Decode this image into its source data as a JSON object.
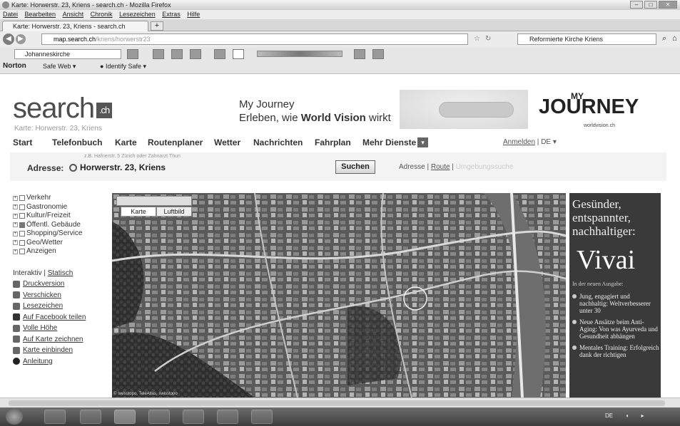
{
  "window": {
    "title": "Karte: Horwerstr. 23, Kriens - search.ch - Mozilla Firefox"
  },
  "menu": [
    "Datei",
    "Bearbeiten",
    "Ansicht",
    "Chronik",
    "Lesezeichen",
    "Extras",
    "Hilfe"
  ],
  "tab": {
    "label": "Karte: Horwerstr. 23, Kriens - search.ch"
  },
  "navbar": {
    "url_domain": "map.search.ch",
    "url_rest": "/kriens/horwerstr23",
    "search_value": "Reformierte Kirche Kriens"
  },
  "toolbar": {
    "search_value": "Johanneskirche",
    "norton_label": "Norton",
    "safeweb_label": "Safe Web",
    "identity_label": "Identify Safe"
  },
  "site": {
    "logo_text": "search",
    "logo_suffix": ".ch",
    "subtitle": "Karte: Horwerstr. 23, Kriens",
    "banner_line1": "My Journey",
    "banner_line2_prefix": "Erleben, wie",
    "banner_line2_bold": "World Vision",
    "banner_line2_suffix": "wirkt",
    "journey_my": "MY",
    "journey_word": "JOURNEY",
    "journey_sub": "worldvision.ch"
  },
  "mainnav": [
    "Start",
    "Telefonbuch",
    "Karte",
    "Routenplaner",
    "Wetter",
    "Nachrichten",
    "Fahrplan",
    "Mehr Dienste"
  ],
  "usernav": {
    "login": "Anmelden",
    "lang": "DE"
  },
  "search": {
    "hint": "z.B. Hafnerstr. 5 Zürich  oder  Zahnarzt Thun",
    "label": "Adresse:",
    "value": "Horwerstr. 23, Kriens",
    "button": "Suchen",
    "mode_adresse": "Adresse",
    "mode_route": "Route",
    "mode_other": "Umgebungssuche"
  },
  "layers": [
    {
      "label": "Verkehr",
      "checked": false
    },
    {
      "label": "Gastronomie",
      "checked": false
    },
    {
      "label": "Kultur/Freizeit",
      "checked": false
    },
    {
      "label": "Öffentl. Gebäude",
      "checked": true
    },
    {
      "label": "Shopping/Service",
      "checked": false
    },
    {
      "label": "Geo/Wetter",
      "checked": false
    },
    {
      "label": "Anzeigen",
      "checked": false
    }
  ],
  "viewmode": {
    "interactive": "Interaktiv",
    "static": "Statisch"
  },
  "tools": [
    "Druckversion",
    "Verschicken",
    "Lesezeichen",
    "Auf Facebook teilen",
    "Volle Höhe",
    "Auf Karte zeichnen",
    "Karte einbinden",
    "Anleitung"
  ],
  "map": {
    "tab_map": "Karte",
    "tab_aerial": "Luftbild",
    "copyright": "© swisstopo, TeleAtlas, swisstopo"
  },
  "ad": {
    "headline": "Gesünder, entspannter, nachhaltiger:",
    "brand": "Vivai",
    "subline": "In der neuen Ausgabe:",
    "bullets": [
      "Jung, engagiert und nachhaltig: Weltverbesserer unter 30",
      "Neue Ansätze beim Anti-Aging: Von was Ayurveda und Gesundheit abhängen",
      "Mentales Training: Erfolgreich dank der richtigen"
    ]
  },
  "tray": {
    "lang": "DE"
  }
}
